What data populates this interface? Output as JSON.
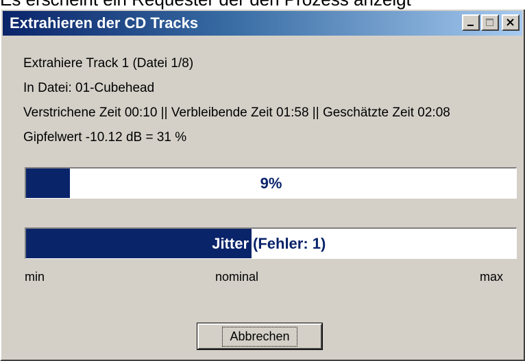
{
  "caption": "Es erscheint ein Requester der den Prozess anzeigt",
  "window": {
    "title": "Extrahieren der CD Tracks",
    "controls": {
      "minimize": "minimize-icon",
      "maximize": "maximize-icon",
      "close": "close-icon"
    }
  },
  "info": {
    "track_line": "Extrahiere Track 1  (Datei 1/8)",
    "file_line": "In Datei: 01-Cubehead",
    "time_line": "Verstrichene Zeit 00:10 || Verbleibende Zeit 01:58 || Geschätzte Zeit 02:08",
    "peak_line": "Gipfelwert -10.12 dB =  31 %"
  },
  "progress": {
    "label": "9%",
    "fraction": 0.09
  },
  "jitter": {
    "label": "Jitter",
    "errors": "(Fehler: 1)",
    "level": 0.46
  },
  "scale": {
    "min": "min",
    "nominal": "nominal",
    "max": "max"
  },
  "buttons": {
    "cancel": "Abbrechen"
  },
  "colors": {
    "accent": "#0a246a",
    "dialog_bg": "#d4d0c8",
    "title_gradient_end": "#a6caf0"
  }
}
